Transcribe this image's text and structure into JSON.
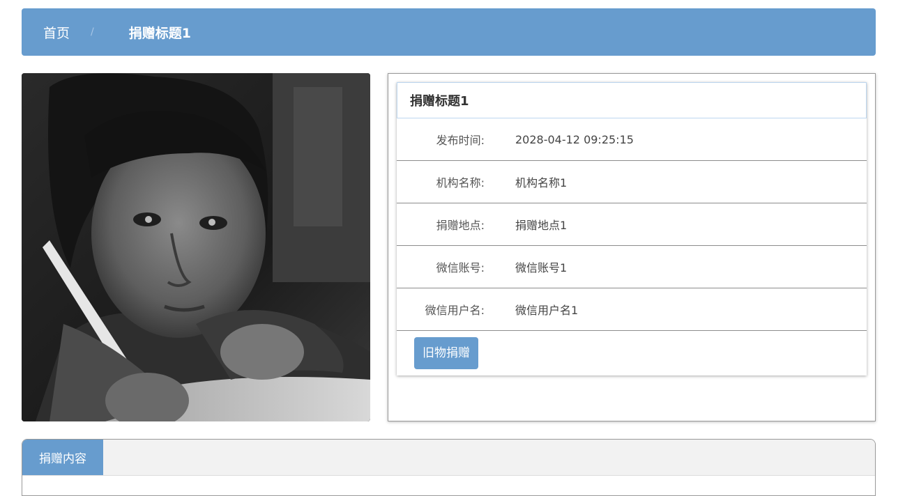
{
  "breadcrumb": {
    "home": "首页",
    "separator": "/",
    "current": "捐赠标题1"
  },
  "detail": {
    "title": "捐赠标题1",
    "rows": [
      {
        "label": "发布时间:",
        "value": "2028-04-12 09:25:15"
      },
      {
        "label": "机构名称:",
        "value": "机构名称1"
      },
      {
        "label": "捐赠地点:",
        "value": "捐赠地点1"
      },
      {
        "label": "微信账号:",
        "value": "微信账号1"
      },
      {
        "label": "微信用户名:",
        "value": "微信用户名1"
      }
    ],
    "action_label": "旧物捐赠"
  },
  "tabs": {
    "active": "捐赠内容"
  },
  "colors": {
    "accent": "#679cce",
    "title_border": "#bcd6f0"
  }
}
